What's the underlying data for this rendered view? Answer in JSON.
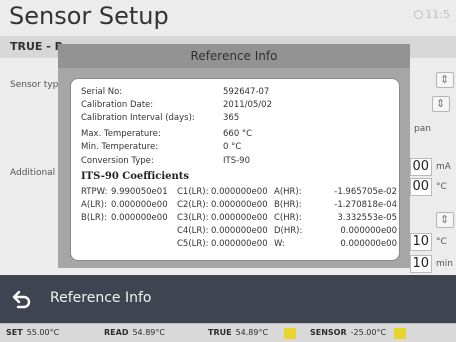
{
  "app": {
    "title": "Sensor Setup",
    "clock_text": "11:5",
    "top_label": "TRUE - R",
    "sensor_type_label": "Sensor typ",
    "additional_label": "Additional s",
    "pan_label": "pan",
    "right_values": [
      {
        "value": "00",
        "unit": "mA"
      },
      {
        "value": "00",
        "unit": "°C"
      },
      {
        "value": "10",
        "unit": "°C"
      },
      {
        "value": "10",
        "unit": "min"
      }
    ]
  },
  "dialog": {
    "title": "Reference Info",
    "fields": [
      {
        "label": "Serial No:",
        "value": "592647-07"
      },
      {
        "label": "Calibration Date:",
        "value": "2011/05/02"
      },
      {
        "label": "Calibration Interval (days):",
        "value": "365"
      },
      {
        "label": "Max. Temperature:",
        "value": "660 °C"
      },
      {
        "label": "Min. Temperature:",
        "value": "0 °C"
      },
      {
        "label": "Conversion Type:",
        "value": "ITS-90"
      }
    ],
    "coefficients_title": "ITS-90 Coefficients",
    "coefficients": {
      "col1": [
        {
          "label": "RTPW:",
          "value": "9.990050e01"
        },
        {
          "label": "A(LR):",
          "value": "0.000000e00"
        },
        {
          "label": "B(LR):",
          "value": "0.000000e00"
        }
      ],
      "col2": [
        {
          "label": "C1(LR):",
          "value": "0.000000e00"
        },
        {
          "label": "C2(LR):",
          "value": "0.000000e00"
        },
        {
          "label": "C3(LR):",
          "value": "0.000000e00"
        },
        {
          "label": "C4(LR):",
          "value": "0.000000e00"
        },
        {
          "label": "C5(LR):",
          "value": "0.000000e00"
        }
      ],
      "col3": [
        {
          "label": "A(HR):",
          "value": "-1.965705e-02"
        },
        {
          "label": "B(HR):",
          "value": "-1.270818e-04"
        },
        {
          "label": "C(HR):",
          "value": "3.332553e-05"
        },
        {
          "label": "D(HR):",
          "value": "0.000000e00"
        },
        {
          "label": "W:",
          "value": "0.000000e00"
        }
      ]
    }
  },
  "bottom": {
    "back_label": "Reference Info"
  },
  "status": {
    "set_label": "SET",
    "set_value": "55.00°C",
    "read_label": "READ",
    "read_value": "54.89°C",
    "true_label": "TRUE",
    "true_value": "54.89°C",
    "sensor_label": "SENSOR",
    "sensor_value": "-25.00°C"
  },
  "colors": {
    "bottom_bar": "#3f4550",
    "dialog_header": "#939393",
    "dialog_body": "#a6a6a6",
    "status_flag": "#e8d42a"
  },
  "icons": {
    "back": "back-arrow-icon",
    "clock": "clock-icon"
  }
}
